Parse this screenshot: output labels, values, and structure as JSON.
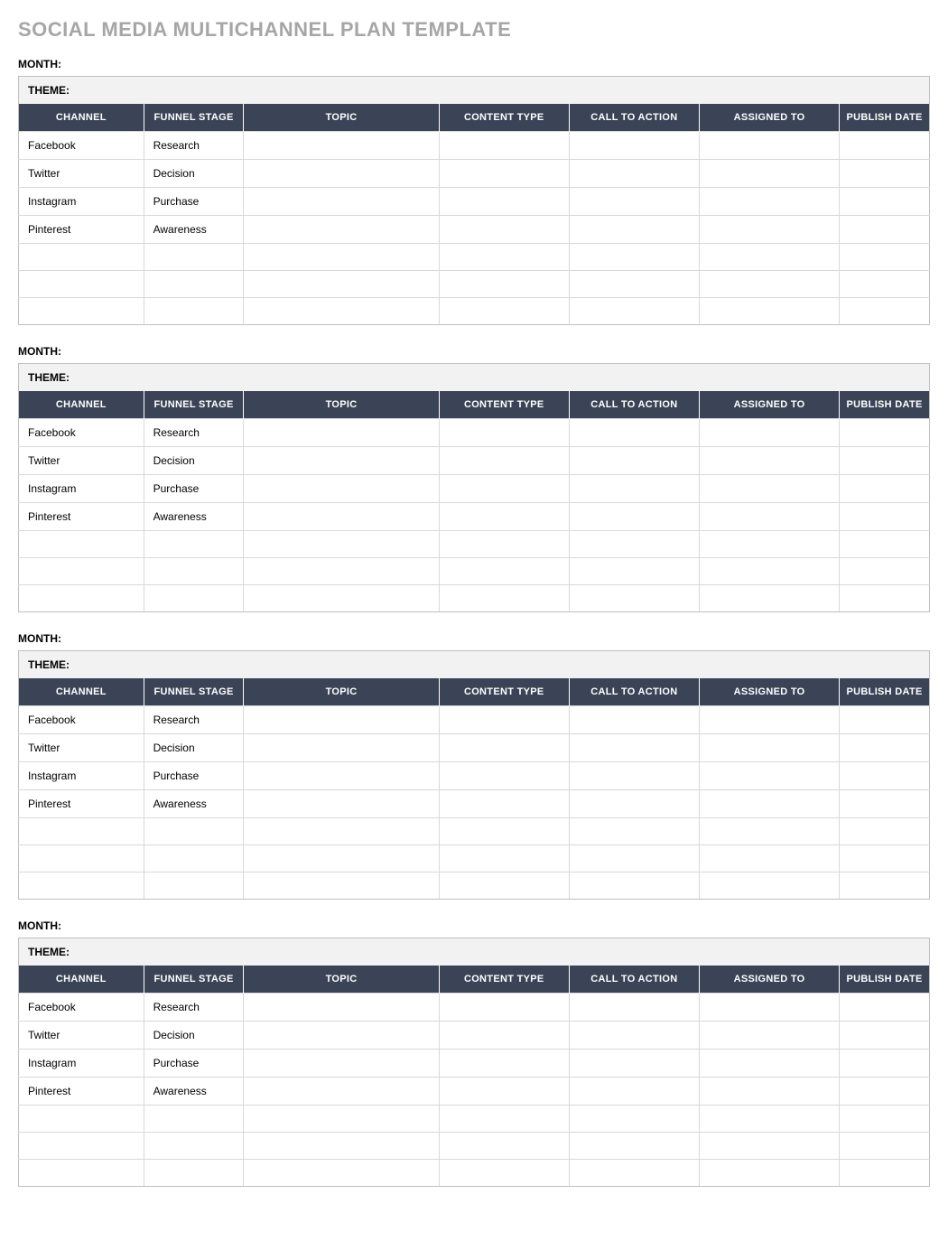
{
  "title": "SOCIAL MEDIA MULTICHANNEL PLAN TEMPLATE",
  "labels": {
    "month": "MONTH:",
    "theme": "THEME:"
  },
  "columns": {
    "channel": "CHANNEL",
    "funnel_stage": "FUNNEL STAGE",
    "topic": "TOPIC",
    "content_type": "CONTENT TYPE",
    "call_to_action": "CALL TO ACTION",
    "assigned_to": "ASSIGNED TO",
    "publish_date": "PUBLISH DATE"
  },
  "sections": [
    {
      "month": "",
      "theme": "",
      "rows": [
        {
          "channel": "Facebook",
          "funnel_stage": "Research",
          "topic": "",
          "content_type": "",
          "call_to_action": "",
          "assigned_to": "",
          "publish_date": ""
        },
        {
          "channel": "Twitter",
          "funnel_stage": "Decision",
          "topic": "",
          "content_type": "",
          "call_to_action": "",
          "assigned_to": "",
          "publish_date": ""
        },
        {
          "channel": "Instagram",
          "funnel_stage": "Purchase",
          "topic": "",
          "content_type": "",
          "call_to_action": "",
          "assigned_to": "",
          "publish_date": ""
        },
        {
          "channel": "Pinterest",
          "funnel_stage": "Awareness",
          "topic": "",
          "content_type": "",
          "call_to_action": "",
          "assigned_to": "",
          "publish_date": ""
        },
        {
          "channel": "",
          "funnel_stage": "",
          "topic": "",
          "content_type": "",
          "call_to_action": "",
          "assigned_to": "",
          "publish_date": ""
        },
        {
          "channel": "",
          "funnel_stage": "",
          "topic": "",
          "content_type": "",
          "call_to_action": "",
          "assigned_to": "",
          "publish_date": ""
        },
        {
          "channel": "",
          "funnel_stage": "",
          "topic": "",
          "content_type": "",
          "call_to_action": "",
          "assigned_to": "",
          "publish_date": ""
        }
      ]
    },
    {
      "month": "",
      "theme": "",
      "rows": [
        {
          "channel": "Facebook",
          "funnel_stage": "Research",
          "topic": "",
          "content_type": "",
          "call_to_action": "",
          "assigned_to": "",
          "publish_date": ""
        },
        {
          "channel": "Twitter",
          "funnel_stage": "Decision",
          "topic": "",
          "content_type": "",
          "call_to_action": "",
          "assigned_to": "",
          "publish_date": ""
        },
        {
          "channel": "Instagram",
          "funnel_stage": "Purchase",
          "topic": "",
          "content_type": "",
          "call_to_action": "",
          "assigned_to": "",
          "publish_date": ""
        },
        {
          "channel": "Pinterest",
          "funnel_stage": "Awareness",
          "topic": "",
          "content_type": "",
          "call_to_action": "",
          "assigned_to": "",
          "publish_date": ""
        },
        {
          "channel": "",
          "funnel_stage": "",
          "topic": "",
          "content_type": "",
          "call_to_action": "",
          "assigned_to": "",
          "publish_date": ""
        },
        {
          "channel": "",
          "funnel_stage": "",
          "topic": "",
          "content_type": "",
          "call_to_action": "",
          "assigned_to": "",
          "publish_date": ""
        },
        {
          "channel": "",
          "funnel_stage": "",
          "topic": "",
          "content_type": "",
          "call_to_action": "",
          "assigned_to": "",
          "publish_date": ""
        }
      ]
    },
    {
      "month": "",
      "theme": "",
      "rows": [
        {
          "channel": "Facebook",
          "funnel_stage": "Research",
          "topic": "",
          "content_type": "",
          "call_to_action": "",
          "assigned_to": "",
          "publish_date": ""
        },
        {
          "channel": "Twitter",
          "funnel_stage": "Decision",
          "topic": "",
          "content_type": "",
          "call_to_action": "",
          "assigned_to": "",
          "publish_date": ""
        },
        {
          "channel": "Instagram",
          "funnel_stage": "Purchase",
          "topic": "",
          "content_type": "",
          "call_to_action": "",
          "assigned_to": "",
          "publish_date": ""
        },
        {
          "channel": "Pinterest",
          "funnel_stage": "Awareness",
          "topic": "",
          "content_type": "",
          "call_to_action": "",
          "assigned_to": "",
          "publish_date": ""
        },
        {
          "channel": "",
          "funnel_stage": "",
          "topic": "",
          "content_type": "",
          "call_to_action": "",
          "assigned_to": "",
          "publish_date": ""
        },
        {
          "channel": "",
          "funnel_stage": "",
          "topic": "",
          "content_type": "",
          "call_to_action": "",
          "assigned_to": "",
          "publish_date": ""
        },
        {
          "channel": "",
          "funnel_stage": "",
          "topic": "",
          "content_type": "",
          "call_to_action": "",
          "assigned_to": "",
          "publish_date": ""
        }
      ]
    },
    {
      "month": "",
      "theme": "",
      "rows": [
        {
          "channel": "Facebook",
          "funnel_stage": "Research",
          "topic": "",
          "content_type": "",
          "call_to_action": "",
          "assigned_to": "",
          "publish_date": ""
        },
        {
          "channel": "Twitter",
          "funnel_stage": "Decision",
          "topic": "",
          "content_type": "",
          "call_to_action": "",
          "assigned_to": "",
          "publish_date": ""
        },
        {
          "channel": "Instagram",
          "funnel_stage": "Purchase",
          "topic": "",
          "content_type": "",
          "call_to_action": "",
          "assigned_to": "",
          "publish_date": ""
        },
        {
          "channel": "Pinterest",
          "funnel_stage": "Awareness",
          "topic": "",
          "content_type": "",
          "call_to_action": "",
          "assigned_to": "",
          "publish_date": ""
        },
        {
          "channel": "",
          "funnel_stage": "",
          "topic": "",
          "content_type": "",
          "call_to_action": "",
          "assigned_to": "",
          "publish_date": ""
        },
        {
          "channel": "",
          "funnel_stage": "",
          "topic": "",
          "content_type": "",
          "call_to_action": "",
          "assigned_to": "",
          "publish_date": ""
        },
        {
          "channel": "",
          "funnel_stage": "",
          "topic": "",
          "content_type": "",
          "call_to_action": "",
          "assigned_to": "",
          "publish_date": ""
        }
      ]
    }
  ]
}
